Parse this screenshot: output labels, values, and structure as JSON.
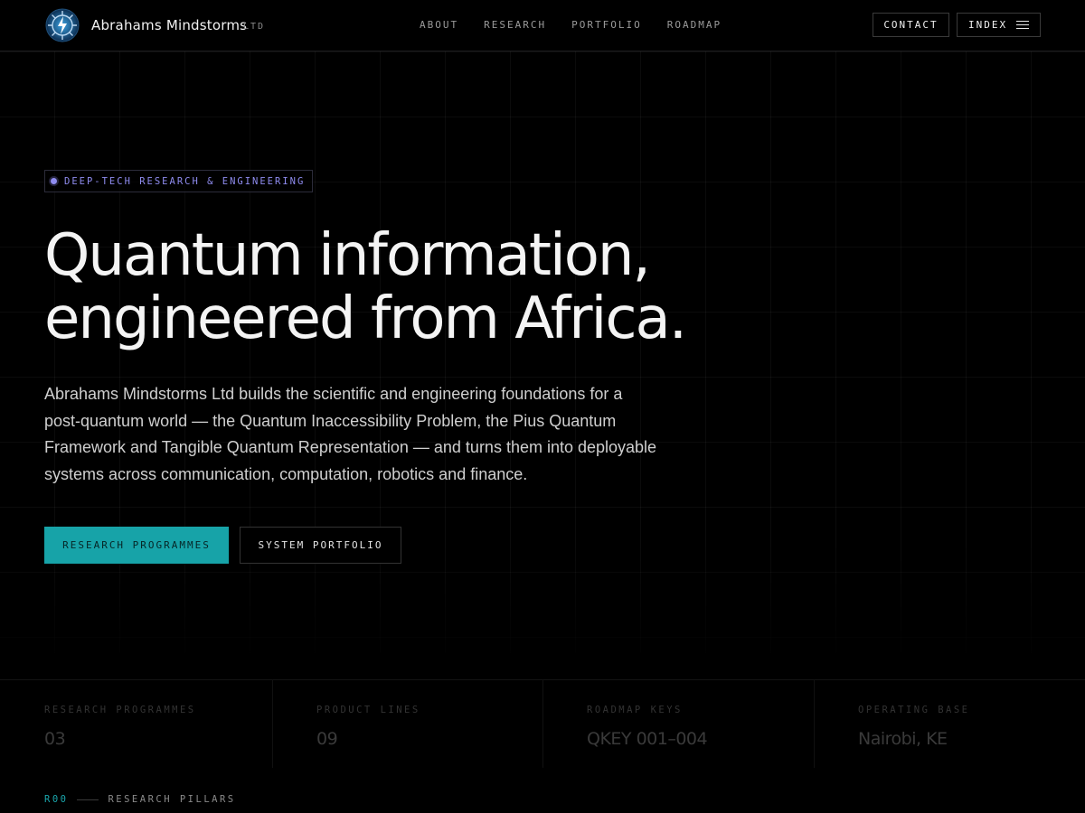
{
  "nav": {
    "brand": "Abrahams Mindstorms",
    "brand_suffix": "LTD",
    "links": [
      "ABOUT",
      "RESEARCH",
      "PORTFOLIO",
      "ROADMAP"
    ],
    "contact_label": "CONTACT",
    "index_label": "INDEX",
    "logo_icon": "circuit-brain-logo-icon",
    "menu_icon": "hamburger-menu-icon"
  },
  "hero": {
    "badge": "DEEP-TECH RESEARCH & ENGINEERING",
    "title_line1": "Quantum information,",
    "title_line2": "engineered from Africa.",
    "description": "Abrahams Mindstorms Ltd builds the scientific and engineering foundations for a post-quantum world — the Quantum Inaccessibility Problem, the Pius Quantum Framework and Tangible Quantum Representation — and turns them into deployable systems across communication, computation, robotics and finance.",
    "cta_primary": "RESEARCH PROGRAMMES",
    "cta_secondary": "SYSTEM PORTFOLIO"
  },
  "stats": [
    {
      "label": "RESEARCH PROGRAMMES",
      "value": "03"
    },
    {
      "label": "PRODUCT LINES",
      "value": "09"
    },
    {
      "label": "ROADMAP KEYS",
      "value": "QKEY 001–004"
    },
    {
      "label": "OPERATING BASE",
      "value": "Nairobi, KE"
    }
  ],
  "section": {
    "number": "R00",
    "title": "RESEARCH PILLARS"
  },
  "colors": {
    "accent_teal": "#17a3a8",
    "accent_violet": "#8f8cf0",
    "background": "#000000"
  }
}
